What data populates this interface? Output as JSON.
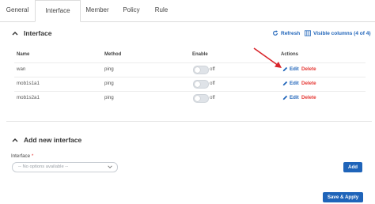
{
  "tabs": [
    {
      "label": "General"
    },
    {
      "label": "Interface"
    },
    {
      "label": "Member"
    },
    {
      "label": "Policy"
    },
    {
      "label": "Rule"
    }
  ],
  "interface_section": {
    "title": "Interface",
    "refresh_label": "Refresh",
    "visible_columns_label": "Visible columns (4 of 4)",
    "columns": [
      "Name",
      "Method",
      "Enable",
      "Actions"
    ],
    "rows": [
      {
        "name": "wan",
        "method": "ping",
        "enable_label": "off",
        "enabled": false,
        "edit_label": "Edit",
        "delete_label": "Delete"
      },
      {
        "name": "mob1s1a1",
        "method": "ping",
        "enable_label": "off",
        "enabled": false,
        "edit_label": "Edit",
        "delete_label": "Delete"
      },
      {
        "name": "mob1s2a1",
        "method": "ping",
        "enable_label": "off",
        "enabled": false,
        "edit_label": "Edit",
        "delete_label": "Delete"
      }
    ]
  },
  "add_section": {
    "title": "Add new interface",
    "field_label": "Interface",
    "required_mark": "*",
    "select_value": "-- No options available --",
    "add_label": "Add"
  },
  "footer": {
    "save_apply_label": "Save & Apply"
  },
  "colors": {
    "accent": "#1f64b9",
    "danger": "#e53935",
    "annotation_arrow": "#d9252b"
  }
}
